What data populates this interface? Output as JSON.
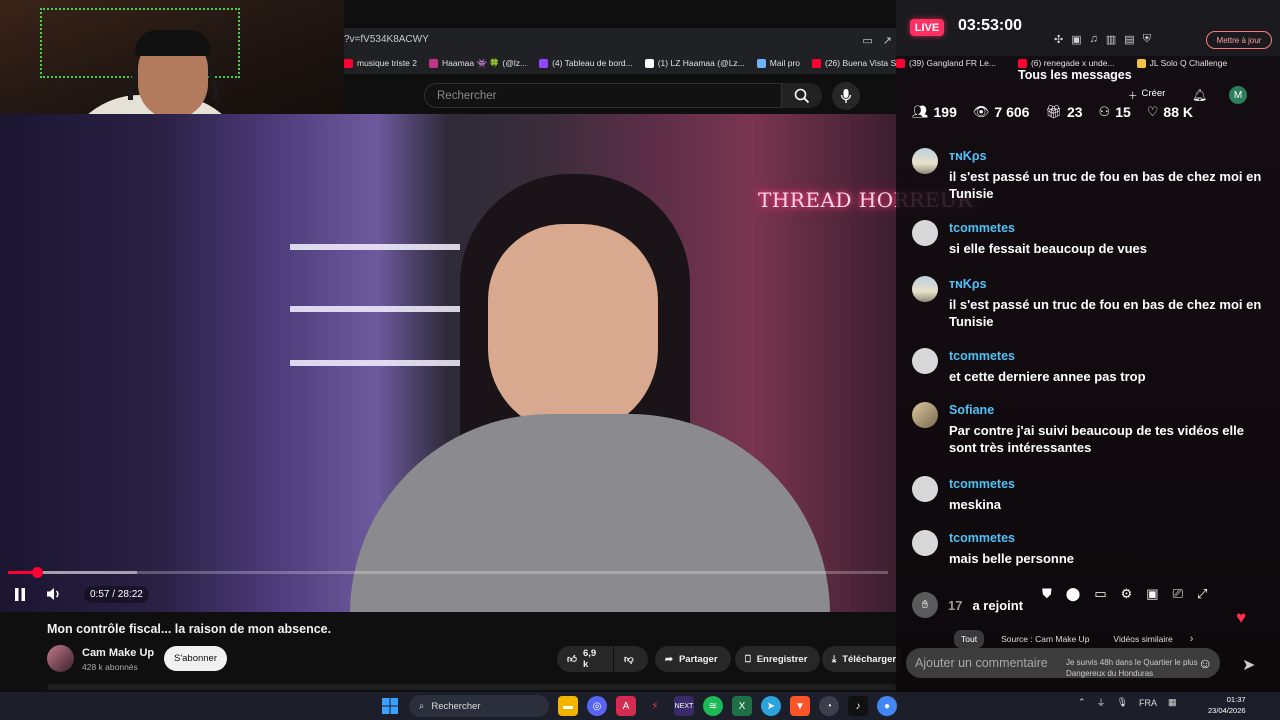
{
  "browser": {
    "url": "?v=fV534K8ACWY",
    "bookmarks": [
      {
        "label": "musique triste 2",
        "color": "#ff0033"
      },
      {
        "label": "Haamaa 👾 🍀 (@lz...",
        "color": "#c13584"
      },
      {
        "label": "(4) Tableau de bord...",
        "color": "#9146ff"
      },
      {
        "label": "(1) LZ Haamaa (@Lz...",
        "color": "#ffffff"
      },
      {
        "label": "Mail pro",
        "color": "#6db3ff"
      },
      {
        "label": "(26) Buena Vista So...",
        "color": "#ff0033"
      },
      {
        "label": "(39) Gangland FR Le...",
        "color": "#ff0033"
      },
      {
        "label": "(6) renegade x unde...",
        "color": "#ff0033"
      },
      {
        "label": "JL Solo Q Challenge",
        "color": "#f4c542"
      }
    ],
    "update_button": "Mettre à jour"
  },
  "youtube": {
    "search_placeholder": "Rechercher",
    "video_overlay_text": "THREAD HORREUR",
    "player": {
      "current_time": "0:57",
      "duration": "28:22",
      "time_display": "0:57 / 28:22",
      "progress_fraction": 0.0335
    },
    "video_title": "Mon contrôle fiscal... la raison de mon absence.",
    "channel": {
      "name": "Cam Make Up",
      "subscribers": "428 k abonnés",
      "subscribe_label": "S'abonner"
    },
    "actions": {
      "likes": "6,9 k",
      "share": "Partager",
      "save": "Enregistrer",
      "download": "Télécharger"
    }
  },
  "stream": {
    "live_badge": "LIVE",
    "live_time": "03:53:00",
    "chat_title": "Tous les messages",
    "create_label": "Créer",
    "user_initial": "M",
    "stats": {
      "viewers": "199",
      "views": "7 606",
      "gifts": "23",
      "followers": "15",
      "likes": "88 K"
    },
    "messages": [
      {
        "user": "тɴKρѕ",
        "color": "#4fc3f7",
        "text": "il s'est passé un truc de fou en bas de chez moi en Tunisie",
        "avatar": "img"
      },
      {
        "user": "tcommetes",
        "color": "#4fc3f7",
        "text": "si elle fessait beaucoup de vues",
        "avatar": "plain"
      },
      {
        "user": "тɴKρѕ",
        "color": "#4fc3f7",
        "text": "il s'est passé un truc de fou en bas de chez moi en Tunisie",
        "avatar": "img"
      },
      {
        "user": "tcommetes",
        "color": "#4fc3f7",
        "text": "et cette derniere annee pas trop",
        "avatar": "plain"
      },
      {
        "user": "Sofiane",
        "color": "#4fc3f7",
        "text": "Par contre j'ai suivi beaucoup de tes vidéos elle sont très intéressantes",
        "avatar": "sof"
      },
      {
        "user": "tcommetes",
        "color": "#4fc3f7",
        "text": "meskina",
        "avatar": "plain"
      },
      {
        "user": "tcommetes",
        "color": "#4fc3f7",
        "text": "mais belle personne",
        "avatar": "plain"
      }
    ],
    "joined": {
      "count": "17",
      "text": "a rejoint"
    },
    "chips": [
      "Tout",
      "Source : Cam Make Up",
      "Vidéos similaire"
    ],
    "comment_placeholder": "Ajouter un commentaire",
    "recommendation": "Je survis 48h dans le Quartier le plus Dangereux du Honduras"
  },
  "taskbar": {
    "search_label": "Rechercher",
    "language": "FRA",
    "time": "01:37",
    "date": "23/04/2026"
  }
}
